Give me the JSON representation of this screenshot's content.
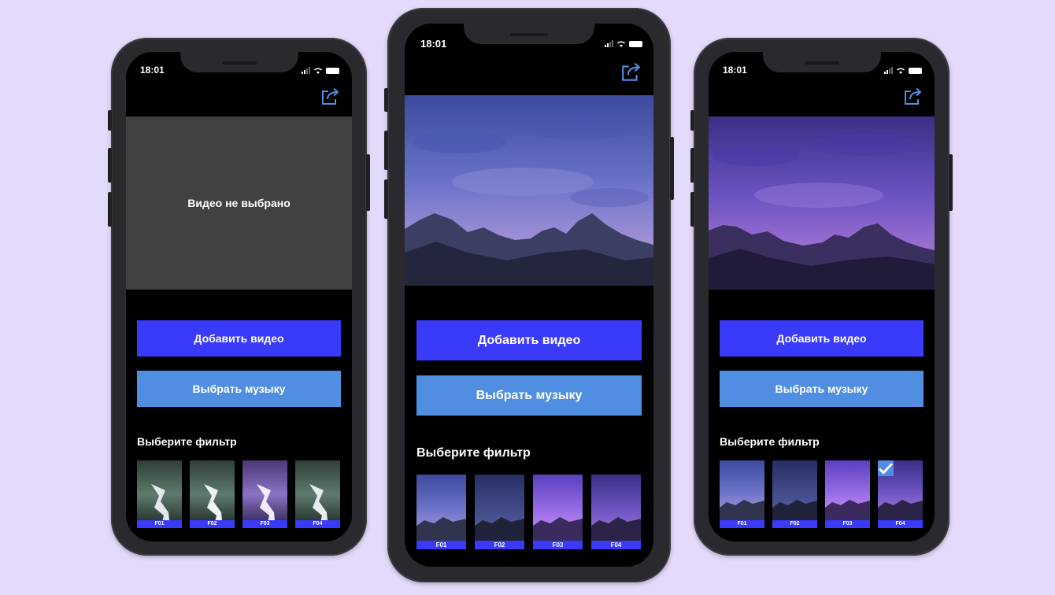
{
  "colors": {
    "background": "#e4dafb",
    "primary_button": "#3a3afb",
    "secondary_button": "#4f8ee0",
    "placeholder": "#414141",
    "accent": "#4f8ee0"
  },
  "screens": [
    {
      "status_time": "18:01",
      "share_icon": "share-icon",
      "preview_placeholder": "Видео не выбрано",
      "add_video_label": "Добавить видео",
      "choose_music_label": "Выбрать музыку",
      "filter_heading": "Выберите фильтр",
      "filters": [
        {
          "label": "F01",
          "selected": false
        },
        {
          "label": "F02",
          "selected": false
        },
        {
          "label": "F03",
          "selected": false
        },
        {
          "label": "F04",
          "selected": false
        }
      ]
    },
    {
      "status_time": "18:01",
      "share_icon": "share-icon",
      "add_video_label": "Добавить видео",
      "choose_music_label": "Выбрать музыку",
      "filter_heading": "Выберите фильтр",
      "filters": [
        {
          "label": "F01",
          "selected": false
        },
        {
          "label": "F02",
          "selected": false
        },
        {
          "label": "F03",
          "selected": false
        },
        {
          "label": "F04",
          "selected": false
        }
      ]
    },
    {
      "status_time": "18:01",
      "share_icon": "share-icon",
      "add_video_label": "Добавить видео",
      "choose_music_label": "Выбрать музыку",
      "filter_heading": "Выберите фильтр",
      "selected_icon": "checkmark-icon",
      "filters": [
        {
          "label": "F01",
          "selected": false
        },
        {
          "label": "F02",
          "selected": false
        },
        {
          "label": "F03",
          "selected": false
        },
        {
          "label": "F04",
          "selected": true
        }
      ]
    }
  ]
}
